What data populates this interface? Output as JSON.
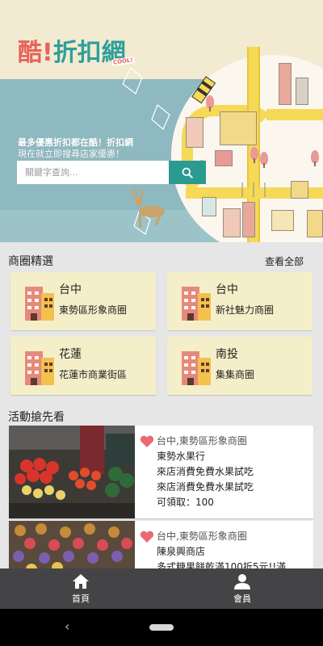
{
  "brand": {
    "logo_text_a": "酷!",
    "logo_text_b": "折扣網",
    "logo_badge": "COOL!"
  },
  "hero": {
    "tagline_1": "最多優惠折扣都在酷！折扣網",
    "tagline_2": "現在就立即搜尋店家優惠！"
  },
  "search": {
    "placeholder": "關鍵字查詢...",
    "icon": "search-icon"
  },
  "districts": {
    "title": "商圈精選",
    "view_all": "查看全部",
    "items": [
      {
        "city": "台中",
        "area": "東勢區形象商圈",
        "icon": "building-icon"
      },
      {
        "city": "台中",
        "area": "新社魅力商圈",
        "icon": "building-icon"
      },
      {
        "city": "花蓮",
        "area": "花蓮市商業街區",
        "icon": "building-icon"
      },
      {
        "city": "南投",
        "area": "集集商圈",
        "icon": "building-icon"
      }
    ]
  },
  "events": {
    "title": "活動搶先看",
    "items": [
      {
        "location": "台中,東勢區形象商圈",
        "shop": "東勢水果行",
        "desc_1": "來店消費免費水果試吃",
        "desc_2": "來店消費免費水果試吃",
        "claim": "可領取：100",
        "icon": "heart-icon"
      },
      {
        "location": "台中,東勢區形象商圈",
        "shop": "陳泉興商店",
        "desc_1": "多式糖果餅乾滿100折5元!!滿",
        "icon": "heart-icon"
      }
    ]
  },
  "nav": {
    "home": "首頁",
    "member": "會員"
  },
  "colors": {
    "accent": "#2b9a91",
    "brand_red": "#e7635a",
    "card_bg": "#f5efc9",
    "nav_bg": "#444446",
    "heart": "#e96a73"
  }
}
